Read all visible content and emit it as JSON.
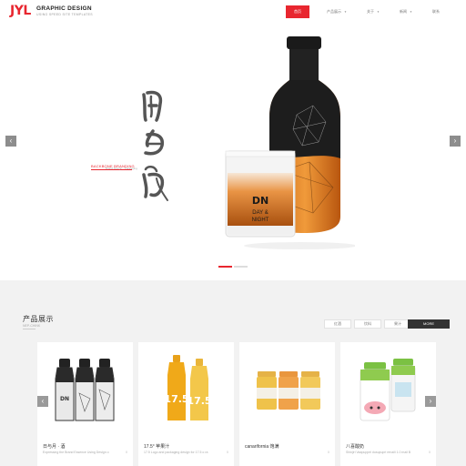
{
  "header": {
    "logo_mark": "JYL",
    "logo_title": "GRAPHIC DESIGN",
    "logo_subtitle": "USING SPEED SITE TEMPLATES",
    "nav": [
      {
        "label": "首页",
        "active": true,
        "dropdown": false
      },
      {
        "label": "产品展示",
        "active": false,
        "dropdown": true
      },
      {
        "label": "关于",
        "active": false,
        "dropdown": true
      },
      {
        "label": "新闻",
        "active": false,
        "dropdown": true
      },
      {
        "label": "联系",
        "active": false,
        "dropdown": false
      }
    ]
  },
  "hero": {
    "tag": "BACKBONE BRANDING",
    "tag_sub": "Brand Design · Packaging",
    "label_line1": "DAY &",
    "label_line2": "NIGHT",
    "prev_icon": "‹",
    "next_icon": "›",
    "slides": 2,
    "active_slide": 0
  },
  "products": {
    "title": "产品展示",
    "subtitle": "NEP-CHINK",
    "tabs": [
      "红酒",
      "饮料",
      "果汁"
    ],
    "more_label": "MORE",
    "prev_icon": "‹",
    "next_icon": "›",
    "items": [
      {
        "title": "日与月 · 酒",
        "desc": "Expressing the Brand Essence Using Design o",
        "count": "0"
      },
      {
        "title": "17.5° 苹果汁",
        "desc": "17.5 Logo and packaging design for 17.5 o ra",
        "count": "0"
      },
      {
        "title": "canarifornia 饱满",
        "desc": "",
        "count": "0"
      },
      {
        "title": "八喜酸奶",
        "desc": "Shinjiri Vaapuppei dusupupri renaili 1.0 mail B",
        "count": "0"
      }
    ]
  },
  "colors": {
    "accent": "#e8262f",
    "dark": "#333333",
    "section_bg": "#f2f2f2"
  }
}
